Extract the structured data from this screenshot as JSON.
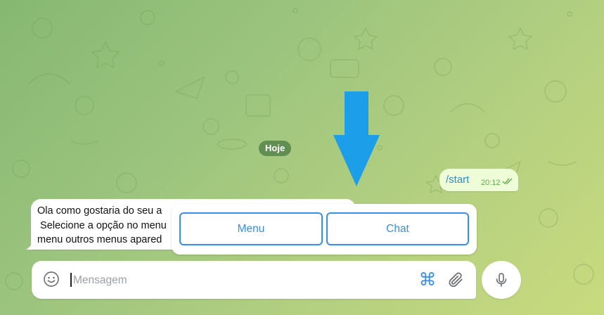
{
  "date_separator": "Hoje",
  "outgoing_message": {
    "text": "/start",
    "time": "20:12",
    "status": "read"
  },
  "incoming_message": {
    "text": "Ola como gostaria do seu a\n Selecione a opção no menu\nmenu outros menus apared"
  },
  "reply_keyboard": {
    "buttons": [
      {
        "label": "Menu"
      },
      {
        "label": "Chat"
      }
    ]
  },
  "composer": {
    "placeholder": "Mensagem",
    "value": "",
    "icons": [
      "smiley-icon",
      "command-icon",
      "paperclip-icon"
    ]
  },
  "mic_icon": "microphone-icon",
  "annotation_arrow_color": "#1c9fe8",
  "colors": {
    "accent": "#3390ec",
    "outgoing_bubble": "#eefcd8",
    "read_ticks": "#5fae4e"
  }
}
